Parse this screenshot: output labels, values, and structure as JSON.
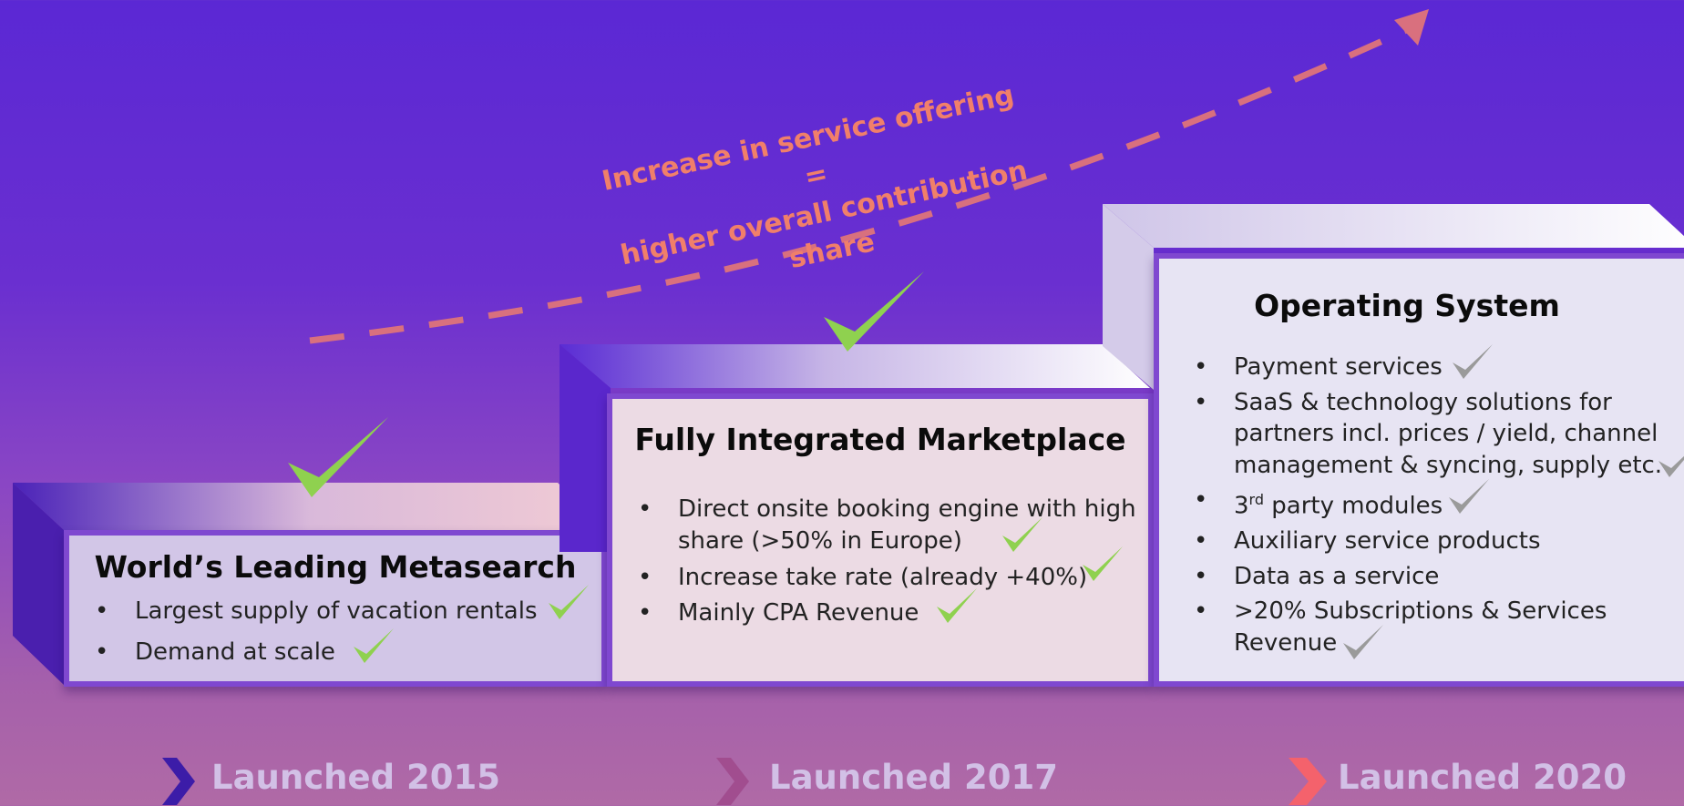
{
  "headline": {
    "line1": "Increase in service offering",
    "line2": "=",
    "line3": "higher overall contribution share"
  },
  "steps": [
    {
      "title": "World’s Leading Metasearch",
      "bullets": [
        "Largest supply of vacation rentals",
        "Demand at scale"
      ],
      "launch": "Launched 2015"
    },
    {
      "title": "Fully Integrated Marketplace",
      "bullets": [
        "Direct onsite booking engine with high",
        "share (>50% in Europe)",
        "Increase take rate (already +40%)",
        "Mainly CPA Revenue"
      ],
      "launch": "Launched 2017"
    },
    {
      "title": "Operating System",
      "bullets": [
        "Payment services",
        "SaaS & technology solutions for",
        "partners incl. prices / yield, channel",
        "management & syncing, supply etc.",
        "3",
        "rd",
        " party modules",
        "Auxiliary service products",
        "Data as a service",
        ">20% Subscriptions & Services",
        "Revenue"
      ],
      "launch": "Launched 2020"
    }
  ],
  "bullet_char": "•",
  "colors": {
    "headline": "#f07f6a",
    "check_green": "#8fd14f",
    "check_gray": "#9a9a9a",
    "chevron1": "#3c1ca8",
    "chevron2": "#a14d8f",
    "chevron3": "#f4626c"
  }
}
